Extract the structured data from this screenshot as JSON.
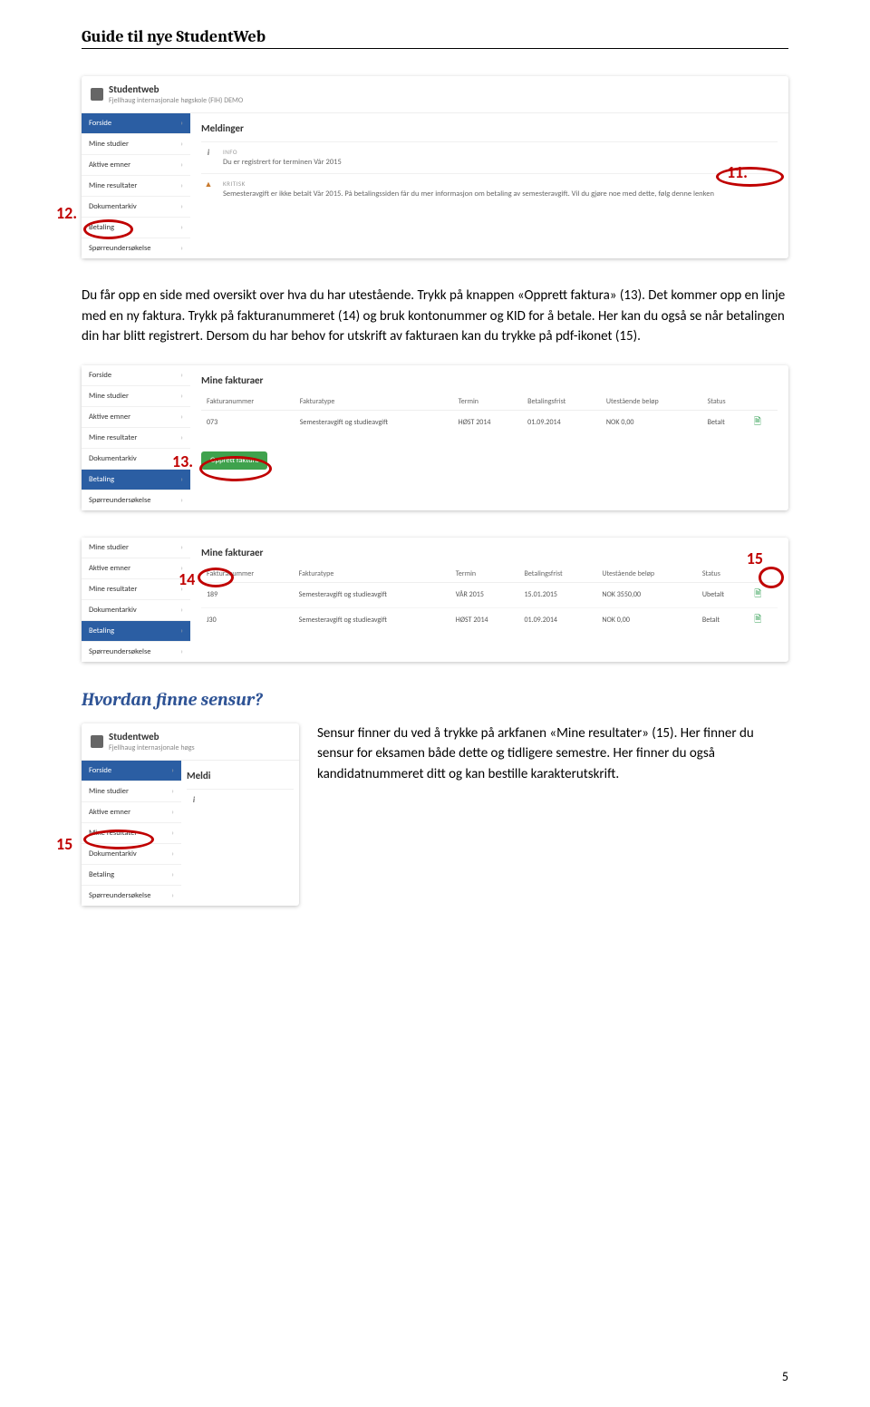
{
  "header": {
    "title": "Guide til nye StudentWeb"
  },
  "brand": {
    "name": "Studentweb",
    "subtitle": "Fjellhaug internasjonale høgskole (FIH) DEMO",
    "subtitle_short": "Fjellhaug internasjonale høgs"
  },
  "sidebar": {
    "forside": "Forside",
    "mine_studier": "Mine studier",
    "aktive_emner": "Aktive emner",
    "mine_resultater": "Mine resultater",
    "dokumentarkiv": "Dokumentarkiv",
    "betaling": "Betaling",
    "sporre": "Spørreundersøkelse"
  },
  "meldinger": {
    "heading": "Meldinger",
    "small_heading": "Meldi",
    "info_label": "INFO",
    "info_text": "Du er registrert for terminen Vår 2015",
    "kritisk_label": "KRITISK",
    "kritisk_text": "Semesteravgift er ikke betalt Vår 2015. På betalingssiden får du mer informasjon om betaling av semesteravgift. Vil du gjøre noe med dette, følg denne lenken"
  },
  "annotations": {
    "a11": "11.",
    "a12": "12.",
    "a13": "13.",
    "a14": "14",
    "a15": "15",
    "a15b": "15"
  },
  "para1": "Du får opp en side med oversikt over hva du har utestående. Trykk på knappen «Opprett faktura» (13). Det kommer opp en linje med en ny faktura. Trykk på fakturanummeret (14) og bruk kontonummer og KID for å betale. Her kan du også se når betalingen din har blitt registrert. Dersom du har behov for utskrift av fakturaen kan du trykke på pdf-ikonet (15).",
  "fakturaer": {
    "heading": "Mine fakturaer",
    "cols": {
      "nr": "Fakturanummer",
      "type": "Fakturatype",
      "termin": "Termin",
      "frist": "Betalingsfrist",
      "belop": "Utestående beløp",
      "status": "Status"
    },
    "row1": {
      "nr": "073",
      "type": "Semesteravgift og studieavgift",
      "termin": "HØST 2014",
      "frist": "01.09.2014",
      "belop": "NOK 0,00",
      "status": "Betalt"
    },
    "create_btn": "Opprett faktura",
    "row2a": {
      "nr": "189",
      "type": "Semesteravgift og studieavgift",
      "termin": "VÅR 2015",
      "frist": "15.01.2015",
      "belop": "NOK 3550,00",
      "status": "Ubetalt"
    },
    "row2b": {
      "nr": "J30",
      "type": "Semesteravgift og studieavgift",
      "termin": "HØST 2014",
      "frist": "01.09.2014",
      "belop": "NOK 0,00",
      "status": "Betalt"
    }
  },
  "section2": {
    "heading": "Hvordan finne sensur?",
    "text": "Sensur finner du ved å trykke på arkfanen «Mine resultater» (15). Her finner du sensur for eksamen både dette og tidligere semestre. Her finner du også kandidatnummeret ditt og kan bestille karakterutskrift."
  },
  "page_number": "5"
}
